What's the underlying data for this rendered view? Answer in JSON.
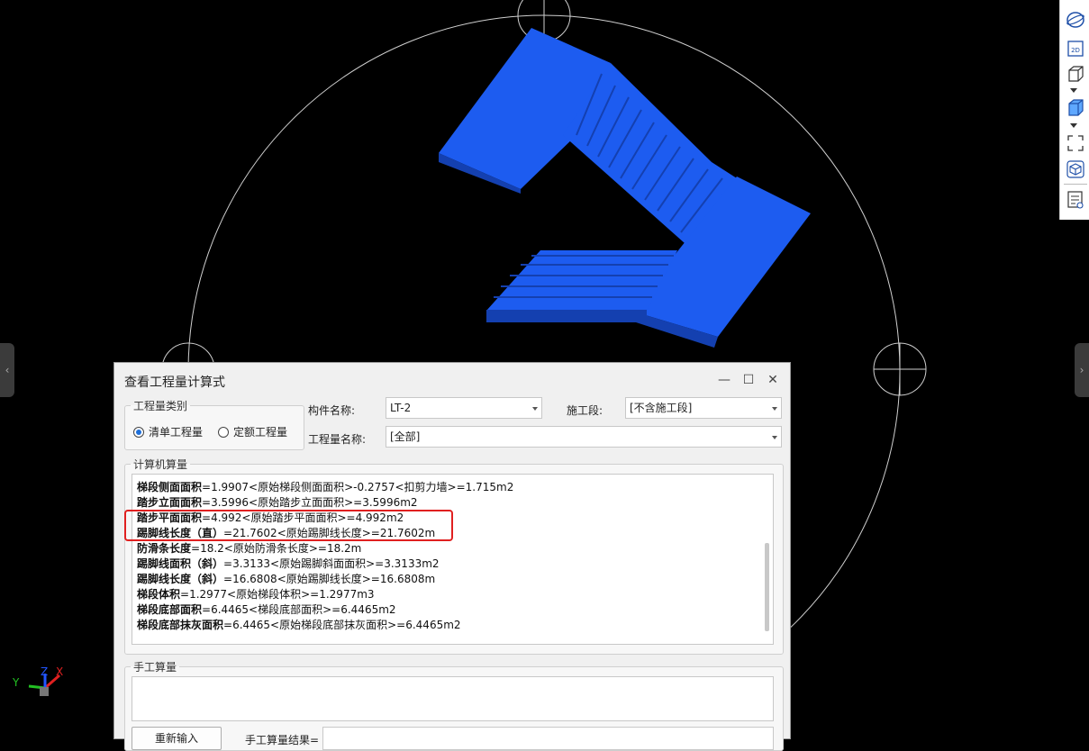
{
  "dialog": {
    "title": "查看工程量计算式",
    "controls": {
      "minimize": "—",
      "maximize": "☐",
      "close": "✕"
    },
    "quantity_type": {
      "legend": "工程量类别",
      "options": [
        {
          "label": "清单工程量",
          "selected": true
        },
        {
          "label": "定额工程量",
          "selected": false
        }
      ]
    },
    "component_name": {
      "label": "构件名称:",
      "value": "LT-2"
    },
    "construction_section": {
      "label": "施工段:",
      "value": "[不含施工段]"
    },
    "quantity_name": {
      "label": "工程量名称:",
      "value": "[全部]"
    },
    "computer_calc": {
      "legend": "计算机算量",
      "lines": [
        {
          "name": "梯段侧面面积",
          "formula": "=1.9907<原始梯段侧面面积>-0.2757<扣剪力墙>=1.715m2"
        },
        {
          "name": "踏步立面面积",
          "formula": "=3.5996<原始踏步立面面积>=3.5996m2"
        },
        {
          "name": "踏步平面面积",
          "formula": "=4.992<原始踏步平面面积>=4.992m2"
        },
        {
          "name": "踢脚线长度（直）",
          "formula": "=21.7602<原始踢脚线长度>=21.7602m"
        },
        {
          "name": "防滑条长度",
          "formula": "=18.2<原始防滑条长度>=18.2m"
        },
        {
          "name": "踢脚线面积（斜）",
          "formula": "=3.3133<原始踢脚斜面面积>=3.3133m2"
        },
        {
          "name": "踢脚线长度（斜）",
          "formula": "=16.6808<原始踢脚线长度>=16.6808m"
        },
        {
          "name": "梯段体积",
          "formula": "=1.2977<原始梯段体积>=1.2977m3"
        },
        {
          "name": "梯段底部面积",
          "formula": "=6.4465<梯段底部面积>=6.4465m2"
        },
        {
          "name": "梯段底部抹灰面积",
          "formula": "=6.4465<原始梯段底部抹灰面积>=6.4465m2"
        }
      ]
    },
    "manual_calc": {
      "legend": "手工算量",
      "reenter_button": "重新输入",
      "result_label": "手工算量结果="
    }
  },
  "axis": {
    "x": "X",
    "y": "Y",
    "z": "Z"
  },
  "colors": {
    "stair": "#1d5cf0",
    "stair_dark": "#1647c2",
    "highlight": "#e02020",
    "accent": "#1e6fd9"
  },
  "toolbar_icons": [
    "orbit-icon",
    "2d-view-icon",
    "cube-wire-icon",
    "cube-solid-icon",
    "fit-view-icon",
    "cube-select-icon",
    "property-list-icon"
  ]
}
